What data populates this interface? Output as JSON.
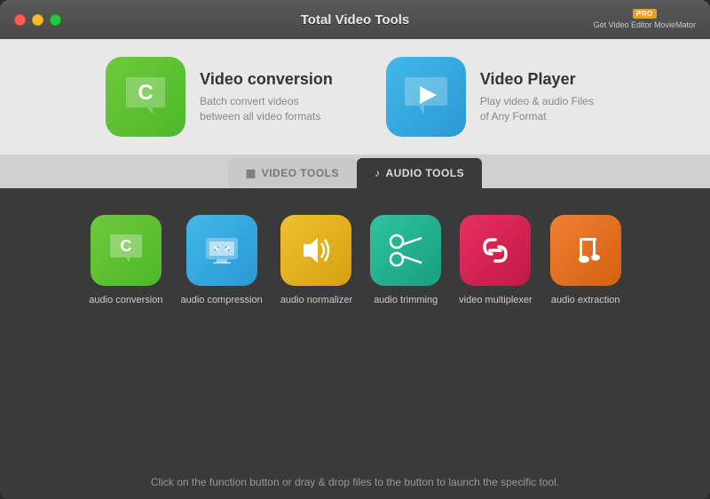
{
  "window": {
    "title": "Total Video Tools"
  },
  "titlebar": {
    "logo_badge": "PRO",
    "logo_text": "Get Video Editor MovieMator"
  },
  "top_features": [
    {
      "id": "video-conversion",
      "title": "Video conversion",
      "desc": "Batch convert videos between all video formats",
      "icon_color": "green"
    },
    {
      "id": "video-player",
      "title": "Video Player",
      "desc": "Play video & audio Files of Any Format",
      "icon_color": "blue"
    }
  ],
  "tabs": [
    {
      "id": "video-tools",
      "label": "VIDEO TOOLS",
      "active": false,
      "icon": "▦"
    },
    {
      "id": "audio-tools",
      "label": "AUDIO TOOLS",
      "active": true,
      "icon": "♪"
    }
  ],
  "tools": [
    {
      "id": "audio-conversion",
      "label": "audio conversion",
      "color": "green"
    },
    {
      "id": "audio-compression",
      "label": "audio compression",
      "color": "blue"
    },
    {
      "id": "audio-normalizer",
      "label": "audio normalizer",
      "color": "yellow"
    },
    {
      "id": "audio-trimming",
      "label": "audio trimming",
      "color": "teal"
    },
    {
      "id": "video-multiplexer",
      "label": "video multiplexer",
      "color": "pink"
    },
    {
      "id": "audio-extraction",
      "label": "audio extraction",
      "color": "orange"
    }
  ],
  "footer": {
    "text": "Click on the function button or dray & drop files to the button to launch the specific tool."
  }
}
